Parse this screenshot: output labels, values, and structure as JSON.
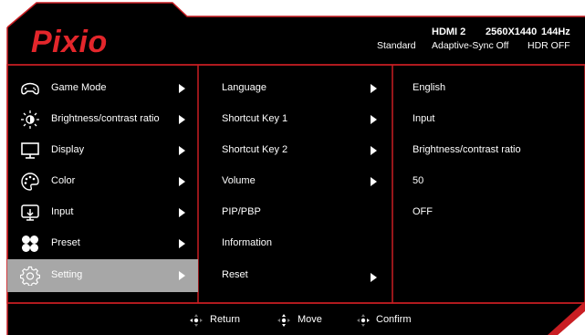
{
  "brand": {
    "logo_text": "Pixio"
  },
  "status": {
    "input": "HDMI 2",
    "resolution": "2560X1440",
    "refresh": "144Hz",
    "mode": "Standard",
    "adaptive_sync": "Adaptive-Sync Off",
    "hdr": "HDR OFF"
  },
  "main_menu": [
    {
      "label": "Game Mode",
      "icon": "gamepad-icon"
    },
    {
      "label": "Brightness/contrast ratio",
      "icon": "brightness-icon"
    },
    {
      "label": "Display",
      "icon": "display-icon"
    },
    {
      "label": "Color",
      "icon": "palette-icon"
    },
    {
      "label": "Input",
      "icon": "input-icon"
    },
    {
      "label": "Preset",
      "icon": "preset-icon"
    },
    {
      "label": "Setting",
      "icon": "gear-icon",
      "selected": true
    }
  ],
  "submenu": [
    {
      "label": "Language",
      "has_arrow": true
    },
    {
      "label": "Shortcut Key 1",
      "has_arrow": true
    },
    {
      "label": "Shortcut Key 2",
      "has_arrow": true
    },
    {
      "label": "Volume",
      "has_arrow": true
    },
    {
      "label": "PIP/PBP",
      "has_arrow": false
    },
    {
      "label": "Information",
      "has_arrow": false
    },
    {
      "label": "Reset",
      "has_arrow": true
    }
  ],
  "values": [
    "English",
    "Input",
    "Brightness/contrast ratio",
    "50",
    "OFF"
  ],
  "footer": {
    "return_label": "Return",
    "move_label": "Move",
    "confirm_label": "Confirm"
  },
  "colors": {
    "background": "#000000",
    "border": "#c91e23",
    "brand_red": "#e3262b",
    "highlight": "#a7a7a7",
    "text": "#ffffff"
  }
}
